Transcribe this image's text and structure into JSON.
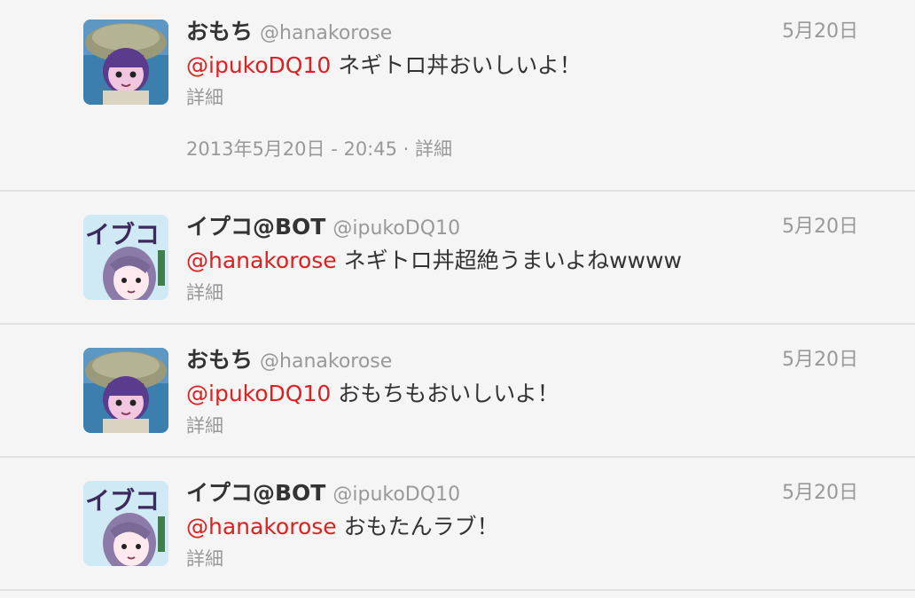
{
  "tweets": [
    {
      "name": "おもち",
      "handle": "@hanakorose",
      "date": "5月20日",
      "mention": "@ipukoDQ10",
      "text": " ネギトロ丼おいしいよ！",
      "details": "詳細",
      "timestamp": "2013年5月20日 - 20:45 · 詳細",
      "avatar_icon": "omochi-avatar-icon"
    },
    {
      "name": "イプコ@BOT",
      "handle": "@ipukoDQ10",
      "date": "5月20日",
      "mention": "@hanakorose",
      "text": " ネギトロ丼超絶うまいよねwwww",
      "details": "詳細",
      "avatar_icon": "ipuko-avatar-icon"
    },
    {
      "name": "おもち",
      "handle": "@hanakorose",
      "date": "5月20日",
      "mention": "@ipukoDQ10",
      "text": " おもちもおいしいよ！",
      "details": "詳細",
      "avatar_icon": "omochi-avatar-icon"
    },
    {
      "name": "イプコ@BOT",
      "handle": "@ipukoDQ10",
      "date": "5月20日",
      "mention": "@hanakorose",
      "text": " おもたんラブ！",
      "details": "詳細",
      "avatar_icon": "ipuko-avatar-icon"
    }
  ],
  "colors": {
    "background": "#f5f5f5",
    "mention": "#e02020",
    "name": "#333333",
    "muted": "#999999",
    "divider": "#e2e2e2"
  }
}
